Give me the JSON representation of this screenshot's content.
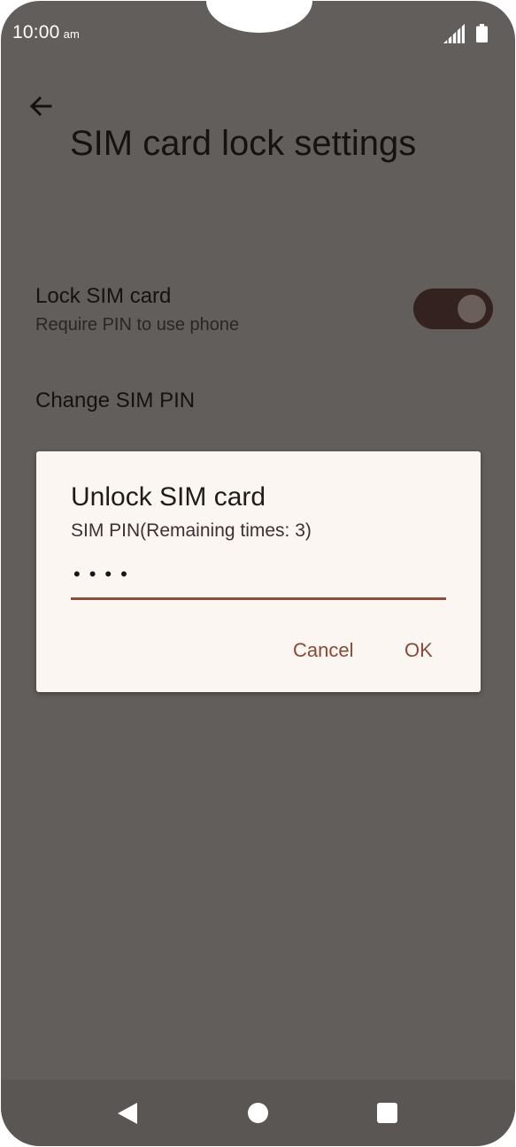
{
  "status_bar": {
    "time": "10:00",
    "ampm": "am",
    "signal_icon": "cell-signal-icon",
    "battery_icon": "battery-full-icon"
  },
  "header": {
    "back_icon": "arrow-back-icon",
    "title": "SIM card lock settings"
  },
  "settings": {
    "lock_sim": {
      "title": "Lock SIM card",
      "subtitle": "Require PIN to use phone",
      "toggle_on": true
    },
    "change_pin": {
      "title": "Change SIM PIN"
    }
  },
  "dialog": {
    "title": "Unlock SIM card",
    "subtitle": "SIM PIN(Remaining times: 3)",
    "pin_masked": "••••",
    "cancel_label": "Cancel",
    "ok_label": "OK"
  },
  "colors": {
    "screen_dim": "#625e5c",
    "dialog_bg": "#fbf6f2",
    "accent": "#8a4a36",
    "toggle_track": "#33221f"
  },
  "nav_bar": {
    "back_icon": "nav-back-triangle-icon",
    "home_icon": "nav-home-circle-icon",
    "recents_icon": "nav-recents-square-icon"
  }
}
